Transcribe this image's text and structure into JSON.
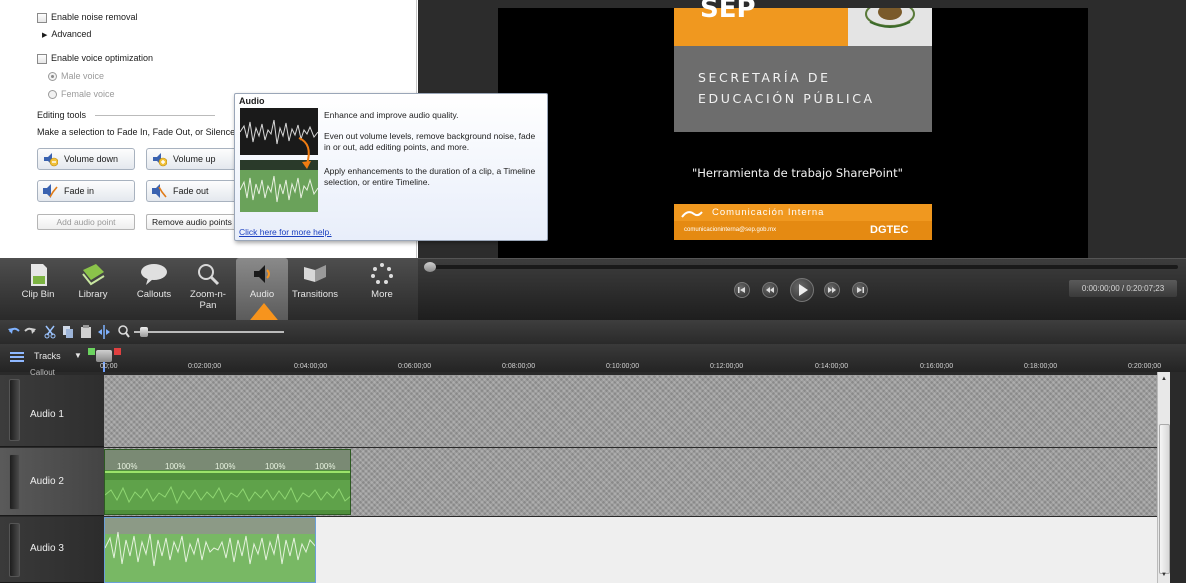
{
  "panel": {
    "noise_removal_label": "Enable noise removal",
    "advanced_label": "Advanced",
    "voice_opt_label": "Enable voice optimization",
    "male_voice_label": "Male voice",
    "female_voice_label": "Female voice",
    "editing_tools_heading": "Editing tools",
    "editing_tools_desc": "Make a selection to Fade In, Fade Out, or Silence a",
    "buttons": {
      "volume_down": "Volume down",
      "volume_up": "Volume up",
      "fade_in": "Fade in",
      "fade_out": "Fade out",
      "add_point": "Add audio point",
      "remove_points": "Remove audio points"
    }
  },
  "tooltip": {
    "title": "Audio",
    "p1": "Enhance and improve audio quality.",
    "p2": "Even out volume levels, remove background noise, fade in or out, add editing points, and more.",
    "p3": "Apply enhancements to the duration of a clip, a Timeline selection, or entire Timeline.",
    "help_link": "Click here for more help."
  },
  "video": {
    "logo_text": "SEP",
    "line1": "SECRETARÍA DE",
    "line2": "EDUCACIÓN PÚBLICA",
    "quote": "\"Herramienta de trabajo SharePoint\"",
    "banner": "Comunicación Interna",
    "email": "comunicacioninterna@sep.gob.mx",
    "dgtec": "DGTEC"
  },
  "tabs": [
    {
      "label": "Clip Bin"
    },
    {
      "label": "Library"
    },
    {
      "label": "Callouts"
    },
    {
      "label": "Zoom-n-Pan"
    },
    {
      "label": "Audio"
    },
    {
      "label": "Transitions"
    },
    {
      "label": "More"
    }
  ],
  "player": {
    "time": "0:00:00;00 / 0:20:07;23"
  },
  "timeline": {
    "tracks_label": "Tracks",
    "ticks": [
      "00;00",
      "0:02:00;00",
      "0:04:00;00",
      "0:06:00;00",
      "0:08:00;00",
      "0:10:00;00",
      "0:12:00;00",
      "0:14:00;00",
      "0:16:00;00",
      "0:18:00;00",
      "0:20:00;00"
    ],
    "callout_label": "Callout",
    "track_names": [
      "Audio 1",
      "Audio 2",
      "Audio 3"
    ],
    "volume_labels": [
      "100%",
      "100%",
      "100%",
      "100%",
      "100%"
    ]
  },
  "colors": {
    "accent_orange": "#f7941d",
    "sep_orange": "#f0981f",
    "clip_green": "#4f8f3c"
  }
}
